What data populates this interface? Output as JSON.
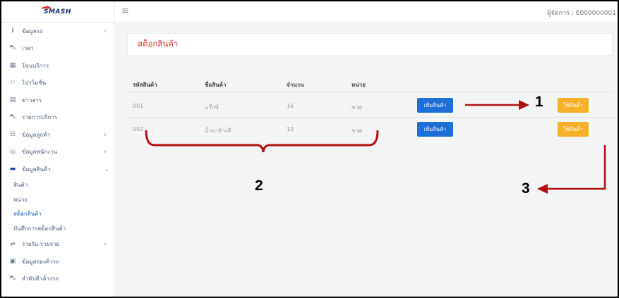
{
  "header": {
    "logo_text": "SMASH",
    "menu_icon": "hamburger-icon",
    "manager_label": "ผู้จัดการ : E000000001"
  },
  "sidebar": {
    "items": [
      {
        "label": "ข้อมูลรถ",
        "icon": "info-icon",
        "chevron": "›"
      },
      {
        "label": "เวลา",
        "icon": "car-icon"
      },
      {
        "label": "โซนบริการ",
        "icon": "grid-icon"
      },
      {
        "label": "โปรโมชั่น",
        "icon": "promo-icon"
      },
      {
        "label": "ข่าวสาร",
        "icon": "news-icon"
      },
      {
        "label": "รายการบริการ",
        "icon": "car-icon"
      },
      {
        "label": "ข้อมูลลูกค้า",
        "icon": "users-icon",
        "chevron": "›"
      },
      {
        "label": "ข้อมูลพนักงาน",
        "icon": "user-circle-icon",
        "chevron": "›"
      },
      {
        "label": "ข้อมูลสินค้า",
        "icon": "box-icon",
        "chevron": "⌄"
      }
    ],
    "sub_items": [
      {
        "label": "สินค้า"
      },
      {
        "label": "หน่วย"
      },
      {
        "label": "สต็อกสินค้า"
      },
      {
        "label": "บันทึกการสต็อกสินค้า"
      }
    ],
    "items_after": [
      {
        "label": "รายรับ-รายจ่าย",
        "icon": "money-icon",
        "chevron": "›"
      },
      {
        "label": "ข้อมูลจองคิวรถ",
        "icon": "book-icon"
      },
      {
        "label": "ลำดับคิวล้างรถ",
        "icon": "car-wash-icon"
      }
    ]
  },
  "page": {
    "title": "สต็อกสินค้า"
  },
  "table": {
    "headers": [
      "รหัสสินค้า",
      "ชื่อสินค้า",
      "จำนวน",
      "หน่วย"
    ],
    "rows": [
      {
        "code": "001",
        "name": "แว๊กซ์",
        "qty": "16",
        "unit": "ขวด",
        "add_label": "เพิ่มสินค้า",
        "use_label": "ใช้สินค้า"
      },
      {
        "code": "002",
        "name": "น้ำยาล้างสี",
        "qty": "10",
        "unit": "ขวด",
        "add_label": "เพิ่มสินค้า",
        "use_label": "ใช้สินค้า"
      }
    ]
  },
  "annotations": {
    "labels": [
      "1",
      "2",
      "3"
    ],
    "color": "#b01010"
  },
  "colors": {
    "title_red": "#e0392c",
    "add_button": "#1e6fd9",
    "use_button": "#f6b02a",
    "active_sub": "#1f5fd6"
  }
}
